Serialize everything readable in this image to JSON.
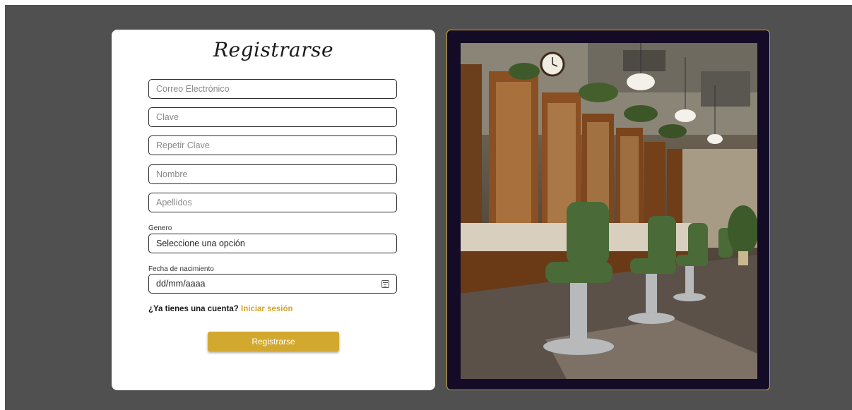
{
  "form": {
    "title": "Registrarse",
    "fields": {
      "email_placeholder": "Correo Electrónico",
      "password_placeholder": "Clave",
      "repeat_password_placeholder": "Repetir Clave",
      "name_placeholder": "Nombre",
      "surname_placeholder": "Apellidos"
    },
    "gender": {
      "label": "Genero",
      "selected": "Seleccione una opción"
    },
    "birthdate": {
      "label": "Fecha de nacimiento",
      "value": "dd/mm/aaaa"
    },
    "login_prompt": {
      "question": "¿Ya tienes una cuenta?",
      "link": "Iniciar sesión"
    },
    "submit_label": "Registrarse"
  },
  "colors": {
    "accent": "#d3a82f",
    "background": "#505050",
    "photo_frame": "#140b26"
  },
  "image": {
    "subject": "barbershop-interior"
  }
}
